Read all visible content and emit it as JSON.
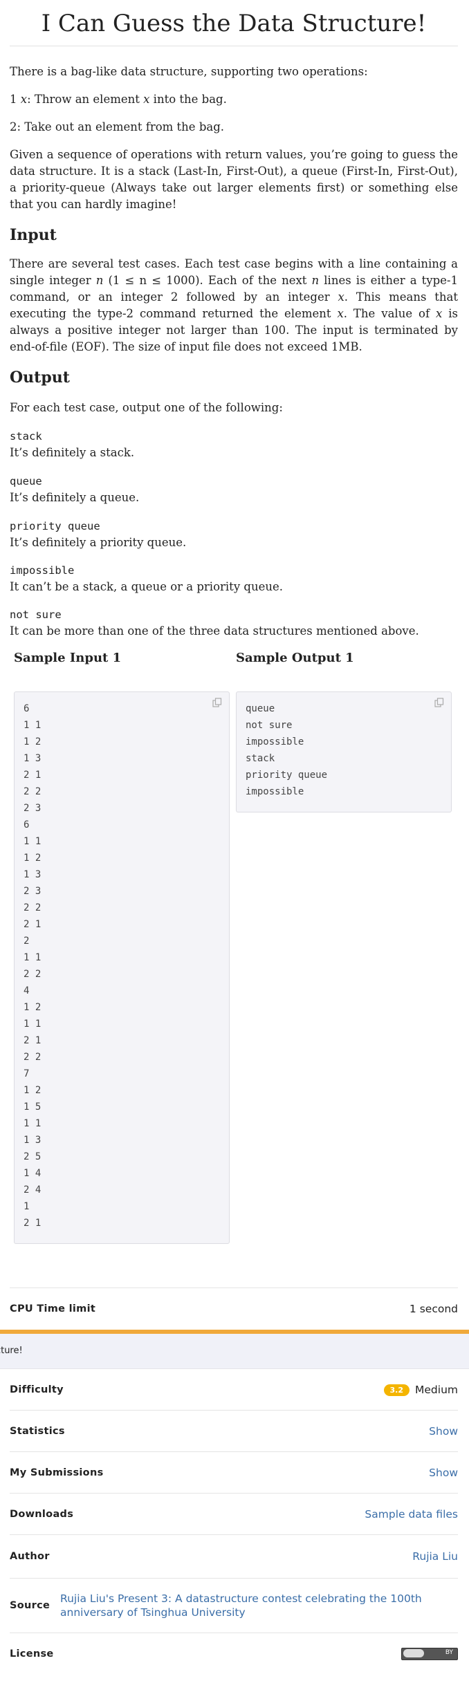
{
  "problem": {
    "title": "I Can Guess the Data Structure!",
    "intro": "There is a bag-like data structure, supporting two operations:",
    "op1_prefix": "1 ",
    "op1_var": "x",
    "op1_text_a": ": Throw an element ",
    "op1_text_b": " into the bag.",
    "op2_text": "2: Take out an element from the bag.",
    "description": "Given a sequence of operations with return values, you’re going to guess the data structure. It is a stack (Last-In, First-Out), a queue (First-In, First-Out), a priority-queue (Always take out larger elements first) or something else that you can hardly imagine!"
  },
  "input_section": {
    "heading": "Input",
    "text_1": "There are several test cases. Each test case begins with a line containing a single integer ",
    "var_n": "n",
    "range": " (1 ≤ n ≤ 1000). ",
    "text_2": "Each of the next ",
    "text_3": " lines is either a type-1 command, or an integer 2 followed by an integer ",
    "var_x": "x",
    "text_4": ". This means that executing the type-2 command returned the element ",
    "text_5": ". The value of ",
    "text_6": " is always a positive integer not larger than 100. The input is terminated by end-of-file (EOF). The size of input file does not exceed 1MB."
  },
  "output_section": {
    "heading": "Output",
    "intro": "For each test case, output one of the following:",
    "options": [
      {
        "code": "stack",
        "meaning": "It’s definitely a stack."
      },
      {
        "code": "queue",
        "meaning": "It’s definitely a queue."
      },
      {
        "code": "priority queue",
        "meaning": "It’s definitely a priority queue."
      },
      {
        "code": "impossible",
        "meaning": "It can’t be a stack, a queue or a priority queue."
      },
      {
        "code": "not sure",
        "meaning": "It can be more than one of the three data structures mentioned above."
      }
    ]
  },
  "samples": {
    "input_heading": "Sample Input 1",
    "output_heading": "Sample Output 1",
    "input_text": "6\n1 1\n1 2\n1 3\n2 1\n2 2\n2 3\n6\n1 1\n1 2\n1 3\n2 3\n2 2\n2 1\n2\n1 1\n2 2\n4\n1 2\n1 1\n2 1\n2 2\n7\n1 2\n1 5\n1 1\n1 3\n2 5\n1 4\n2 4\n1\n2 1",
    "output_text": "queue\nnot sure\nimpossible\nstack\npriority queue\nimpossible"
  },
  "sticky_bar": {
    "text": "I Can Guess the Data Structure!"
  },
  "info": {
    "cpu_label": "CPU Time limit",
    "cpu_value": "1 second",
    "difficulty_label": "Difficulty",
    "difficulty_score": "3.2",
    "difficulty_value": "Medium",
    "statistics_label": "Statistics",
    "statistics_value": "Show",
    "submissions_label": "My Submissions",
    "submissions_value": "Show",
    "downloads_label": "Downloads",
    "downloads_value": "Sample data files",
    "author_label": "Author",
    "author_value": "Rujia Liu",
    "source_label": "Source",
    "source_value": "Rujia Liu's Present 3: A datastructure contest celebrating the 100th anniversary of Tsinghua University",
    "license_label": "License",
    "license_text": "BY"
  },
  "colors": {
    "accent_bar": "#f0a93b",
    "link": "#3b6ea8",
    "badge": "#f4b400"
  }
}
